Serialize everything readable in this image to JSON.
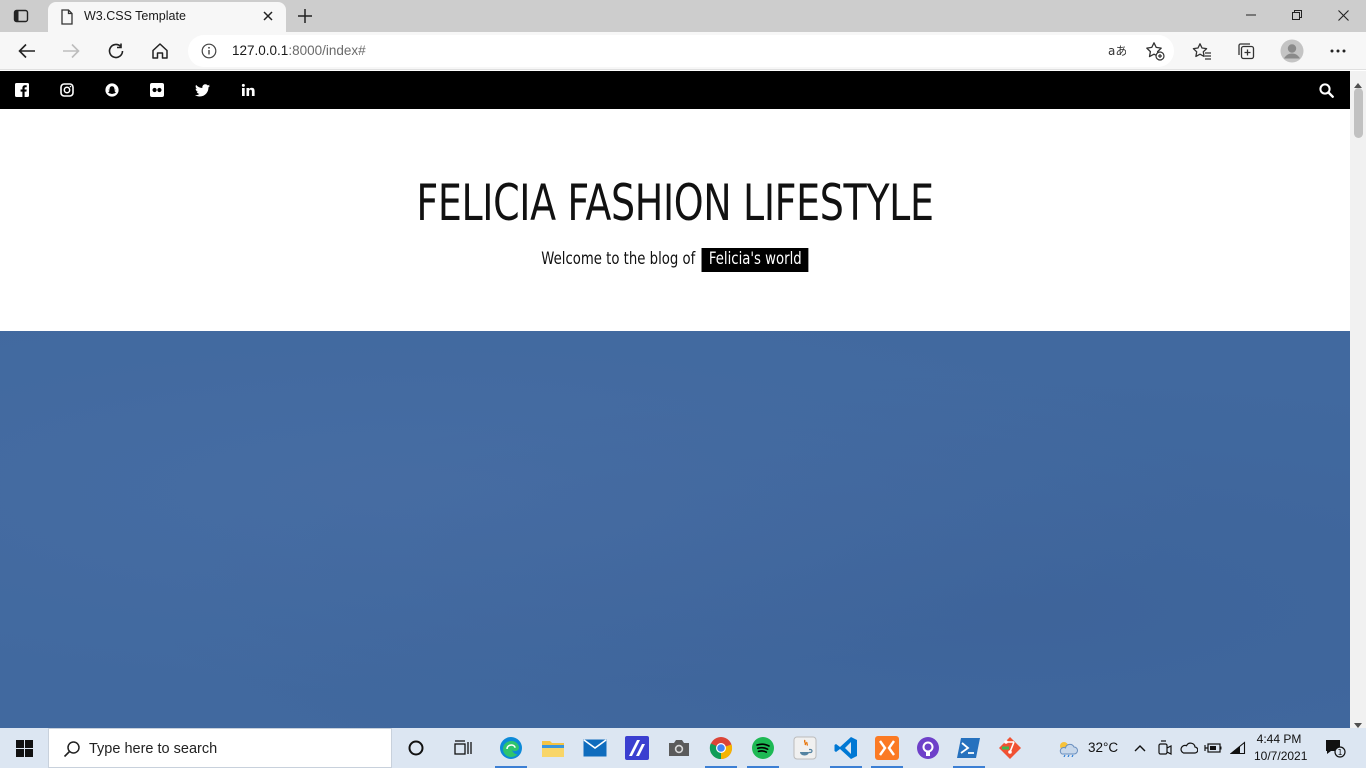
{
  "browser": {
    "tab_title": "W3.CSS Template",
    "url_host": "127.0.0.1",
    "url_rest": ":8000/index#"
  },
  "page": {
    "site_title": "FELICIA FASHION LIFESTYLE",
    "tagline_prefix": "Welcome to the blog of",
    "tagline_highlight": "Felicia's world",
    "social_icons": [
      "facebook-icon",
      "instagram-icon",
      "snapchat-icon",
      "flickr-icon",
      "twitter-icon",
      "linkedin-icon"
    ],
    "hero_color": "#41699f"
  },
  "taskbar": {
    "search_placeholder": "Type here to search",
    "temperature": "32°C",
    "time": "4:44 PM",
    "date": "10/7/2021",
    "notification_count": "1"
  }
}
